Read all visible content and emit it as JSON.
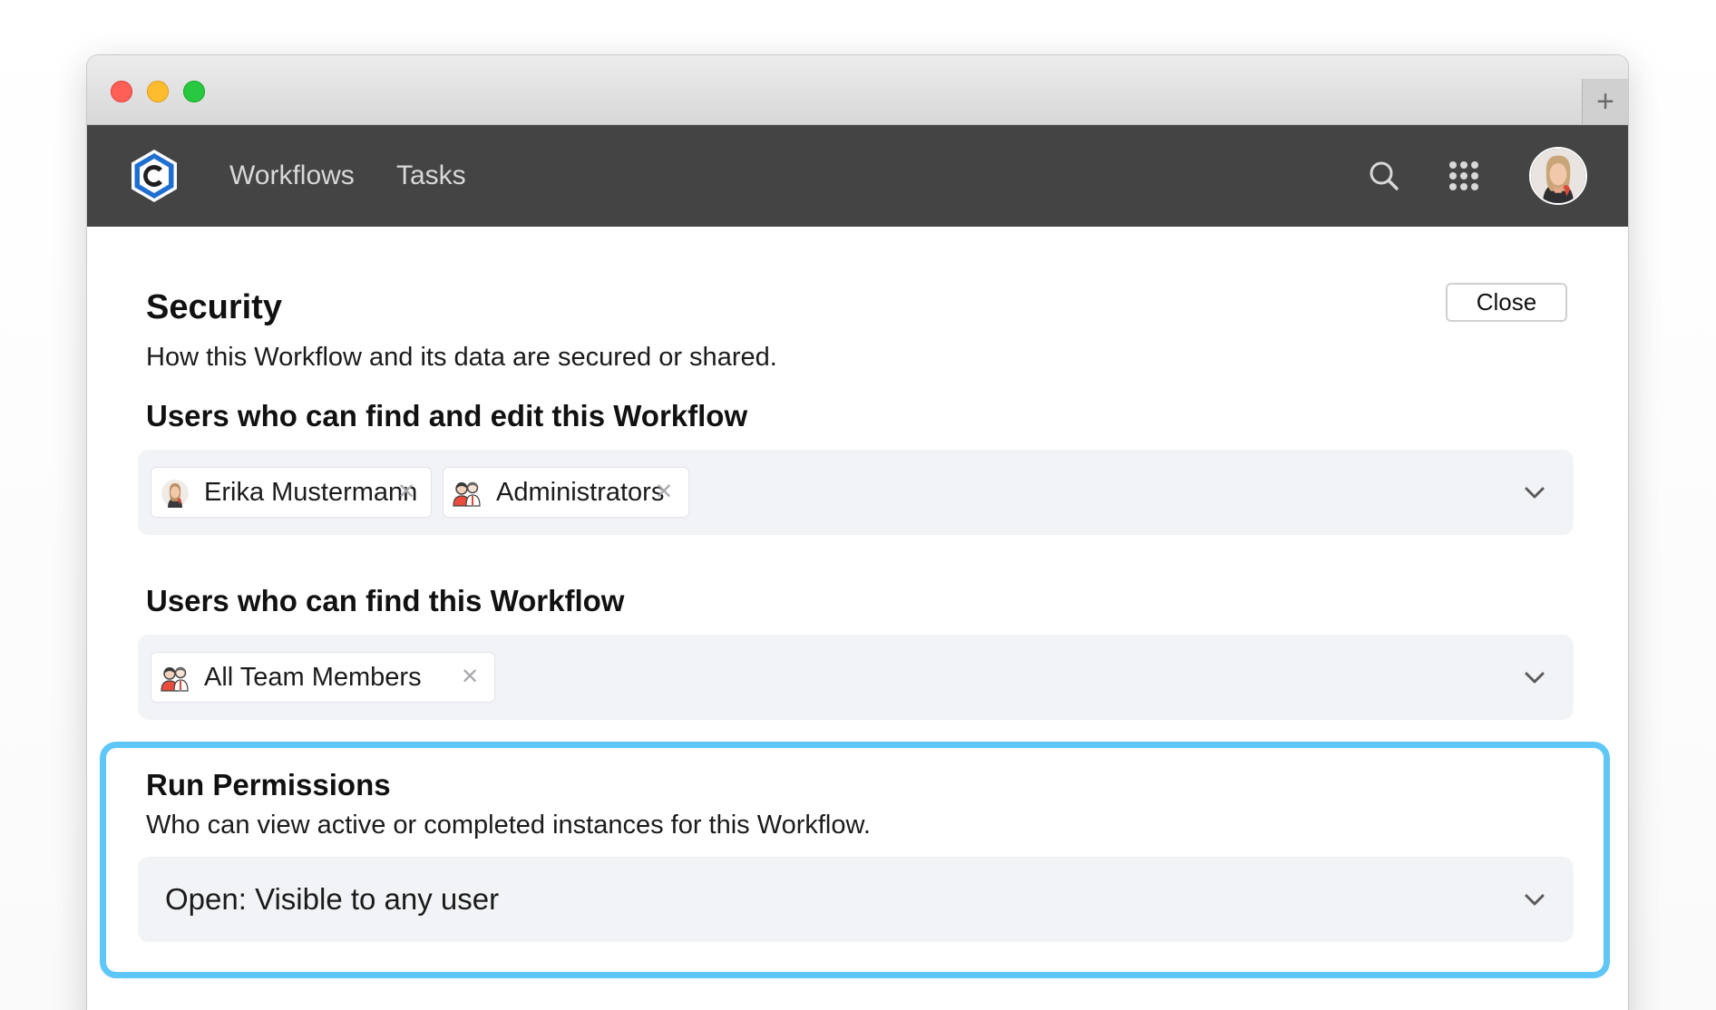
{
  "nav": {
    "links": [
      {
        "label": "Workflows"
      },
      {
        "label": "Tasks"
      }
    ]
  },
  "page": {
    "title": "Security",
    "subtitle": "How this Workflow and its data are secured or shared.",
    "close_label": "Close"
  },
  "sections": {
    "edit": {
      "heading": "Users who can find and edit this Workflow",
      "chips": [
        {
          "label": "Erika Mustermann",
          "icon": "user-avatar-icon"
        },
        {
          "label": "Administrators",
          "icon": "group-icon"
        }
      ]
    },
    "find": {
      "heading": "Users who can find this Workflow",
      "chips": [
        {
          "label": "All Team Members",
          "icon": "group-icon"
        }
      ]
    },
    "run": {
      "heading": "Run Permissions",
      "description": "Who can view active or completed instances for this Workflow.",
      "selected": "Open: Visible to any user"
    }
  },
  "colors": {
    "navbar": "#444444",
    "highlight": "#5ec7f7",
    "select_bg": "#f2f3f6",
    "traffic_red": "#ff5f57",
    "traffic_yellow": "#febc2e",
    "traffic_green": "#28c840"
  }
}
